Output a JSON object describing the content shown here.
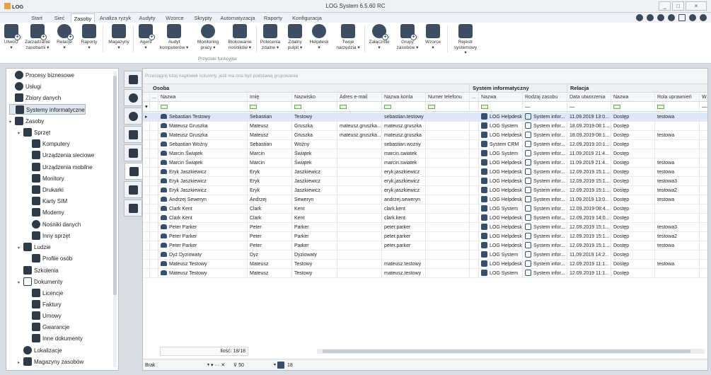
{
  "app": {
    "logo": "LOG",
    "title": "LOG System 6.5.60 RC",
    "window_buttons": [
      "_",
      "□",
      "×"
    ]
  },
  "menu_tabs": [
    "Start",
    "Sieć",
    "Zasoby",
    "Analiza ryzyk",
    "Audyty",
    "Wzorce",
    "Skrypty",
    "Automatyzacja",
    "Raporty",
    "Konfiguracja"
  ],
  "active_menu_tab": "Zasoby",
  "ribbon": {
    "buttons": [
      {
        "label": "Utwórz",
        "sub": "▾"
      },
      {
        "label": "Zarządzanie",
        "sub": "zasobami ▾"
      },
      {
        "label": "Relacje",
        "sub": "▾"
      },
      {
        "label": "Raporty",
        "sub": "▾"
      },
      {
        "label": "Magazyny",
        "sub": "▾"
      },
      {
        "label": "Agent",
        "sub": "▾"
      },
      {
        "label": "Audyt",
        "sub": "komputerów ▾"
      },
      {
        "label": "Monitoring",
        "sub": "pracy ▾"
      },
      {
        "label": "Blokowanie",
        "sub": "nośników ▾"
      },
      {
        "label": "Polecenia",
        "sub": "zdalne ▾"
      },
      {
        "label": "Zdalny",
        "sub": "pulpit ▾"
      },
      {
        "label": "Helpdesk",
        "sub": "▾"
      },
      {
        "label": "Twoje",
        "sub": "narzędzia ▾"
      },
      {
        "label": "Załączniki",
        "sub": "▾"
      },
      {
        "label": "Grupy",
        "sub": "zasobów ▾"
      },
      {
        "label": "Wzorce",
        "sub": "▾"
      },
      {
        "label": "Rejestr",
        "sub": "systemowy ▾"
      }
    ],
    "group_label": "Przyciski funkcyjne"
  },
  "tree": {
    "nodes": [
      {
        "label": "Procesy biznesowe",
        "level": 0,
        "toggle": ""
      },
      {
        "label": "Usługi",
        "level": 0,
        "toggle": ""
      },
      {
        "label": "Zbiory danych",
        "level": 0,
        "toggle": ""
      },
      {
        "label": "Systemy informatyczne",
        "level": 0,
        "toggle": "",
        "selected": true
      },
      {
        "label": "Zasoby",
        "level": 0,
        "toggle": "▾"
      },
      {
        "label": "Sprzęt",
        "level": 1,
        "toggle": "▾"
      },
      {
        "label": "Komputery",
        "level": 2,
        "toggle": ""
      },
      {
        "label": "Urządzenia sieciowe",
        "level": 2,
        "toggle": ""
      },
      {
        "label": "Urządzenia mobilne",
        "level": 2,
        "toggle": ""
      },
      {
        "label": "Monitory",
        "level": 2,
        "toggle": ""
      },
      {
        "label": "Drukarki",
        "level": 2,
        "toggle": ""
      },
      {
        "label": "Karty SIM",
        "level": 2,
        "toggle": ""
      },
      {
        "label": "Modemy",
        "level": 2,
        "toggle": ""
      },
      {
        "label": "Nośniki danych",
        "level": 2,
        "toggle": ""
      },
      {
        "label": "Inny sprzęt",
        "level": 2,
        "toggle": ""
      },
      {
        "label": "Ludzie",
        "level": 1,
        "toggle": "▾"
      },
      {
        "label": "Profile osób",
        "level": 2,
        "toggle": ""
      },
      {
        "label": "Szkolenia",
        "level": 1,
        "toggle": ""
      },
      {
        "label": "Dokumenty",
        "level": 1,
        "toggle": "▾"
      },
      {
        "label": "Licencje",
        "level": 2,
        "toggle": ""
      },
      {
        "label": "Faktury",
        "level": 2,
        "toggle": ""
      },
      {
        "label": "Umowy",
        "level": 2,
        "toggle": ""
      },
      {
        "label": "Gwarancje",
        "level": 2,
        "toggle": ""
      },
      {
        "label": "Inne dokumenty",
        "level": 2,
        "toggle": ""
      },
      {
        "label": "Lokalizacje",
        "level": 1,
        "toggle": ""
      },
      {
        "label": "Magazyny zasobów",
        "level": 1,
        "toggle": "▸"
      }
    ]
  },
  "grid": {
    "group_hint": "Przeciągnij tutaj nagłówek kolumny, jeśli ma ona być podstawą grupowania",
    "bands": [
      {
        "label": "Osoba"
      },
      {
        "label": "System informatyczny"
      },
      {
        "label": "Relacja"
      }
    ],
    "headers": [
      "...",
      "Nazwa",
      "Imię",
      "Nazwisko",
      "Adres e-mail",
      "Nazwa konta",
      "Numer telefonu",
      "...",
      "Nazwa",
      "Rodzaj zasobu",
      "Data utworzenia",
      "Nazwa",
      "Rola uprawnień",
      "W"
    ],
    "filter_dash": "—",
    "rows": [
      [
        "Sebastian Testowy",
        "Sebastian",
        "Testowy",
        "",
        "sebastian.testowy",
        "",
        "LOG Helpdesk",
        "System infor...",
        "11.09.2019 13:0...",
        "Dostęp",
        "testowa"
      ],
      [
        "Mateusz Gruszka",
        "Mateusz",
        "Gruszka",
        "mateusz.gruszka...",
        "mateusz.gruszka",
        "",
        "LOG System",
        "System infor...",
        "18.09.2019 08:1...",
        "Dostęp",
        ""
      ],
      [
        "Mateusz Gruszka",
        "Mateusz",
        "Gruszka",
        "mateusz.gruszka...",
        "mateusz.gruszka",
        "",
        "LOG Helpdesk",
        "System infor...",
        "18.09.2019 08:1...",
        "Dostęp",
        "testowa"
      ],
      [
        "Sebastian Woźny",
        "Sebastian",
        "Woźny",
        "",
        "sebastian.wozny",
        "",
        "System CRM",
        "System infor...",
        "12.09.2019 10:1...",
        "Dostęp",
        ""
      ],
      [
        "Marcin Świątek",
        "Marcin",
        "Świątek",
        "",
        "marcin.swiatek",
        "",
        "LOG System",
        "System infor...",
        "11.09.2019 21:4...",
        "Dostęp",
        ""
      ],
      [
        "Marcin Świątek",
        "Marcin",
        "Świątek",
        "",
        "marcin.swiatek",
        "",
        "LOG Helpdesk",
        "System infor...",
        "11.09.2019 21:4...",
        "Dostęp",
        "testowa"
      ],
      [
        "Eryk Jaszkiewicz",
        "Eryk",
        "Jaszkiewicz",
        "",
        "eryk.jaszkiewicz",
        "",
        "LOG Helpdesk",
        "System infor...",
        "12.09.2019 15:1...",
        "Dostęp",
        "testowa"
      ],
      [
        "Eryk Jaszkiewicz",
        "Eryk",
        "Jaszkiewicz",
        "",
        "eryk.jaszkiewicz",
        "",
        "LOG Helpdesk",
        "System infor...",
        "12.09.2019 15:1...",
        "Dostęp",
        "testowa3"
      ],
      [
        "Eryk Jaszkiewicz",
        "Eryk",
        "Jaszkiewicz",
        "",
        "eryk.jaszkiewicz",
        "",
        "LOG Helpdesk",
        "System infor...",
        "12.09.2019 15:1...",
        "Dostęp",
        "testowa2"
      ],
      [
        "Andrzej Seweryn",
        "Andrzej",
        "Seweryn",
        "",
        "andrzej.seweryn",
        "",
        "LOG Helpdesk",
        "System infor...",
        "11.09.2019 13:0...",
        "Dostęp",
        "testowa"
      ],
      [
        "Clark Kent",
        "Clark",
        "Kent",
        "",
        "clark.kent",
        "",
        "LOG System",
        "System infor...",
        "12.09.2019 08:4...",
        "Dostęp",
        ""
      ],
      [
        "Clark Kent",
        "Clark",
        "Kent",
        "",
        "clark.kent",
        "",
        "LOG Helpdesk",
        "System infor...",
        "12.09.2019 14:0...",
        "Dostęp",
        ""
      ],
      [
        "Peter Parker",
        "Peter",
        "Parker",
        "",
        "peter.parker",
        "",
        "LOG Helpdesk",
        "System infor...",
        "12.09.2019 15:1...",
        "Dostęp",
        "testowa3"
      ],
      [
        "Peter Parker",
        "Peter",
        "Parker",
        "",
        "peter.parker",
        "",
        "LOG Helpdesk",
        "System infor...",
        "12.09.2019 15:1...",
        "Dostęp",
        "testowa2"
      ],
      [
        "Peter Parker",
        "Peter",
        "Parker",
        "",
        "peter.parker",
        "",
        "LOG Helpdesk",
        "System infor...",
        "12.09.2019 15:1...",
        "Dostęp",
        "testowa"
      ],
      [
        "Dyż Dyziowaty",
        "Dyż",
        "Dyziowaty",
        "",
        "",
        "",
        "LOG System",
        "System infor...",
        "11.09.2019 14:2...",
        "Dostęp",
        ""
      ],
      [
        "Mateusz Testowy",
        "Mateusz",
        "Testowy",
        "",
        "mateusz.testowy",
        "",
        "LOG Helpdesk",
        "System infor...",
        "12.09.2019 11:1...",
        "Dostęp",
        "testowa"
      ],
      [
        "Mateusz Testowy",
        "Mateusz",
        "Testowy",
        "",
        "mateusz.testowy",
        "",
        "LOG System",
        "System infor...",
        "12.09.2019 11:1...",
        "Dostęp",
        ""
      ]
    ],
    "count_label": "Ilość: 18/18",
    "pager": {
      "filter_select": "Brak",
      "tools": "▾ ··· ✕",
      "page_size": "50",
      "page_count": "18"
    }
  }
}
